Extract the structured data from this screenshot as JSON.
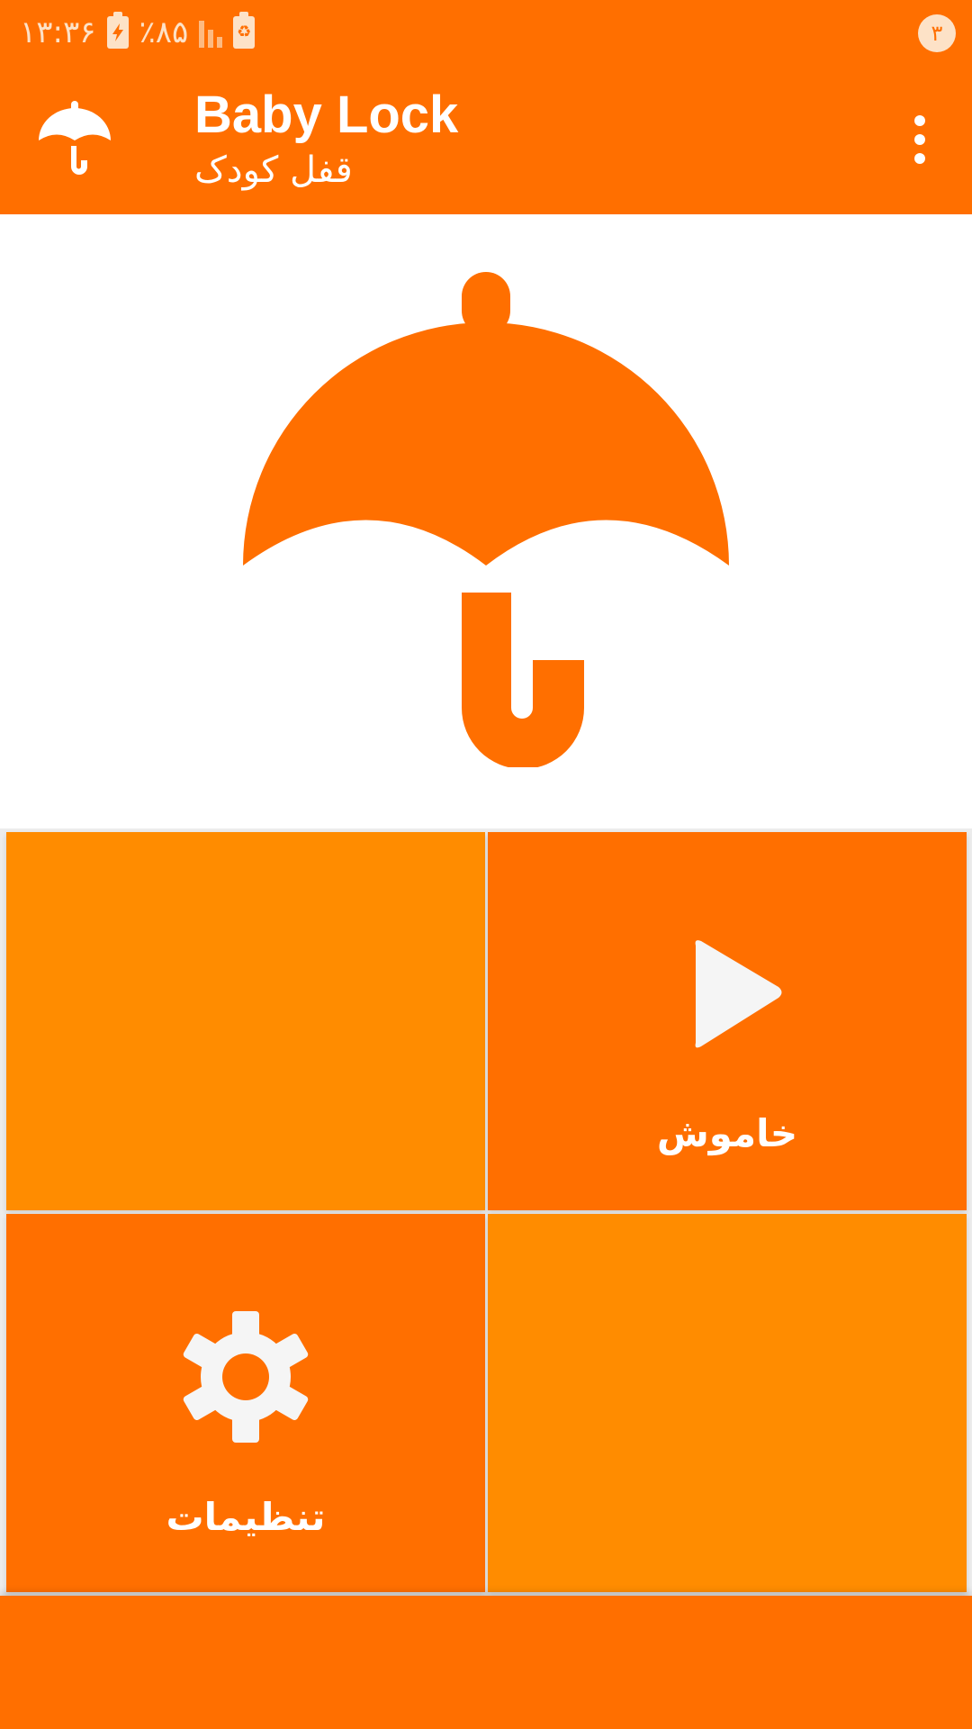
{
  "status_bar": {
    "time": "۱۳:۳۶",
    "battery_percent": "٪۸۵",
    "notification_count": "۳",
    "icons": [
      "battery-charging-icon",
      "signal-icon",
      "battery-saver-icon"
    ]
  },
  "app_bar": {
    "title": "Baby Lock",
    "subtitle": "قفل کودک",
    "app_icon": "umbrella-icon",
    "menu_icon": "more-vert-icon"
  },
  "hero": {
    "icon": "umbrella-icon"
  },
  "tiles": [
    {
      "label": "",
      "icon": ""
    },
    {
      "label": "خاموش",
      "icon": "play-icon"
    },
    {
      "label": "تنظیمات",
      "icon": "gear-icon"
    },
    {
      "label": "",
      "icon": ""
    }
  ],
  "colors": {
    "primary": "#ff6f00",
    "tile_alt": "#ff8c00",
    "status_text": "#fde2c7",
    "icon_fill": "#f5f5f5"
  }
}
